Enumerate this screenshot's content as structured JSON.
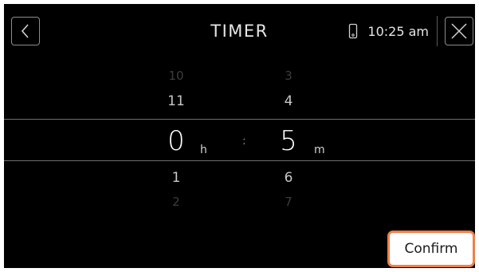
{
  "header": {
    "title": "TIMER",
    "time": "10:25 am",
    "icons": {
      "back": "chevron-left-icon",
      "device": "phone-icon",
      "close": "close-icon"
    }
  },
  "picker": {
    "hours": {
      "prev2": "10",
      "prev1": "11",
      "selected": "0",
      "next1": "1",
      "next2": "2",
      "unit": "h"
    },
    "separator": ":",
    "minutes": {
      "prev2": "3",
      "prev1": "4",
      "selected": "5",
      "next1": "6",
      "next2": "7",
      "unit": "m"
    }
  },
  "footer": {
    "confirm_label": "Confirm"
  },
  "colors": {
    "background": "#000000",
    "accent": "#f07f49",
    "text": "#e6e6e6",
    "divider": "#6e6e6e"
  }
}
